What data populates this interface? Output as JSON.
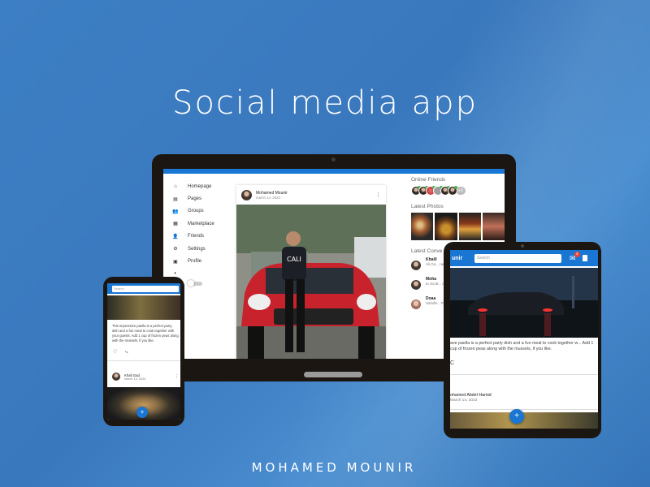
{
  "hero": {
    "title": "Social media app",
    "author": "MOHAMED MOUNIR"
  },
  "laptop": {
    "sidebar": [
      {
        "icon": "home-icon",
        "glyph": "⌂",
        "label": "Homepage"
      },
      {
        "icon": "pages-icon",
        "glyph": "▤",
        "label": "Pages"
      },
      {
        "icon": "groups-icon",
        "glyph": "👥",
        "label": "Groups"
      },
      {
        "icon": "marketplace-icon",
        "glyph": "▦",
        "label": "Marketplace"
      },
      {
        "icon": "friends-icon",
        "glyph": "👤",
        "label": "Friends"
      },
      {
        "icon": "settings-icon",
        "glyph": "⚙",
        "label": "Settings"
      },
      {
        "icon": "profile-icon",
        "glyph": "▣",
        "label": "Profile"
      }
    ],
    "post": {
      "author": "Mohamed Mounir",
      "date": "march 14, 2023",
      "menu_glyph": "⋮"
    },
    "right": {
      "online_title": "Online Friends",
      "more_count": "+3",
      "photos_title": "Latest Photos",
      "conv_title": "Latest Conve",
      "conversations": [
        {
          "name": "Khalil",
          "text": "Ali Ga... neighb... this..."
        },
        {
          "name": "Moha",
          "text": "to Scott... could... this..."
        },
        {
          "name": "Doaa",
          "text": "Sandhi... Paris-... this..."
        }
      ]
    }
  },
  "tablet": {
    "brand": "unir",
    "search_placeholder": "Search",
    "mail_badge": "4",
    "mail_glyph": "✉",
    "description": "ave paella is a perfect party dish and a fun meal to cook together w... Add 1 cup of frozen peas along with the mussels, if you like.",
    "icons_text": "C",
    "author": "ohamed Abdel Hamid",
    "date": "March 14, 2023",
    "fab_glyph": "+"
  },
  "phone": {
    "search_placeholder": "Search",
    "description": "This impressive paella is a perfect party dish and a fun meal to cook together with your guests. Add 1 cup of frozen peas along with the mussels, if you like.",
    "like_glyph": "♡",
    "share_glyph": "⤷",
    "author": "Khali Gad",
    "date": "march 14, 2023",
    "menu_glyph": "⋮",
    "fab_glyph": "+"
  },
  "colors": {
    "background": "#3d7fc4",
    "accent": "#1976d2",
    "device_frame": "#1b1612"
  }
}
